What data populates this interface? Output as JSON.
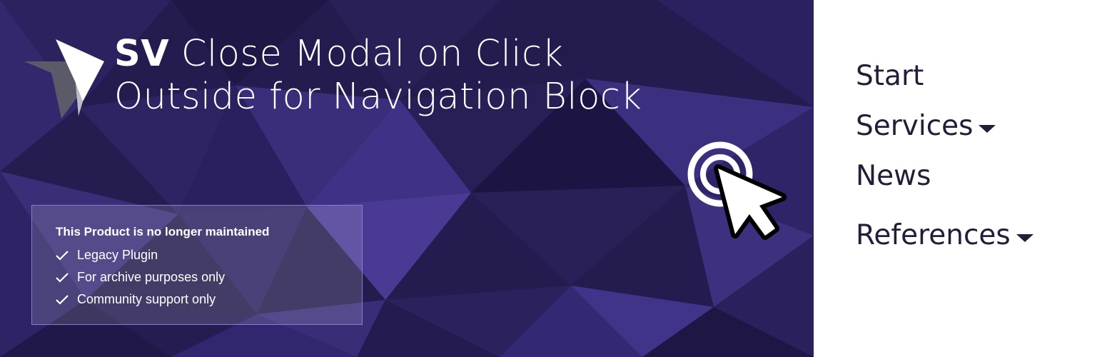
{
  "banner": {
    "title": {
      "brand": "SV",
      "line1": " Close Modal on Click",
      "line2": "Outside for Navigation Block"
    },
    "notice": {
      "heading": "This Product is no longer maintained",
      "items": [
        "Legacy Plugin",
        "For archive purposes only",
        "Community support only"
      ]
    }
  },
  "nav": {
    "items": [
      {
        "label": "Start",
        "has_dropdown": false
      },
      {
        "label": "Services",
        "has_dropdown": true
      },
      {
        "label": "News",
        "has_dropdown": false
      },
      {
        "label": "References",
        "has_dropdown": true
      }
    ]
  },
  "colors": {
    "banner_background": "#231b4e",
    "notice_border": "#8c79d6",
    "nav_text": "#1f1f38",
    "page_background": "#ffffff"
  },
  "icons": [
    "logo-icon",
    "click-target-icon",
    "pointer-cursor-icon",
    "check-icon",
    "caret-down-icon"
  ]
}
